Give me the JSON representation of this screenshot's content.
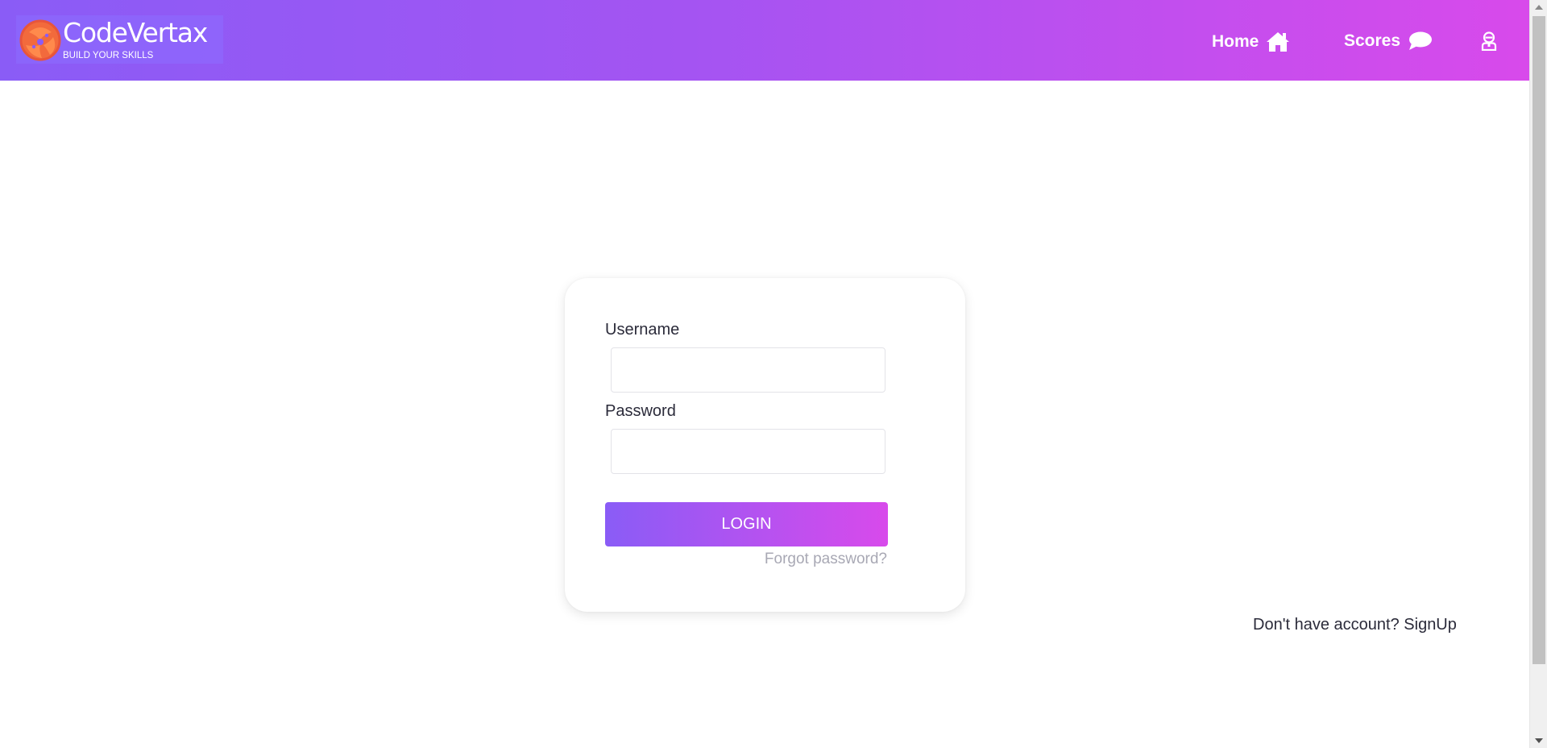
{
  "header": {
    "brand": {
      "title": "CodeVertax",
      "tagline": "BUILD YOUR SKILLS",
      "logo_icon": "atom-logo-icon"
    },
    "nav": [
      {
        "label": "Home",
        "icon": "home-icon"
      },
      {
        "label": "Scores",
        "icon": "chat-bubble-icon"
      }
    ],
    "user_icon": "user-icon"
  },
  "login_form": {
    "username_label": "Username",
    "username_value": "",
    "password_label": "Password",
    "password_value": "",
    "login_button": "LOGIN",
    "forgot_password": "Forgot password?"
  },
  "signup": {
    "prompt": "Don't have account?",
    "link": "SignUp"
  },
  "colors": {
    "gradient_start": "#8a5cf6",
    "gradient_end": "#d84aeb",
    "text": "#2b2b3a",
    "muted": "#a8a8b4"
  }
}
